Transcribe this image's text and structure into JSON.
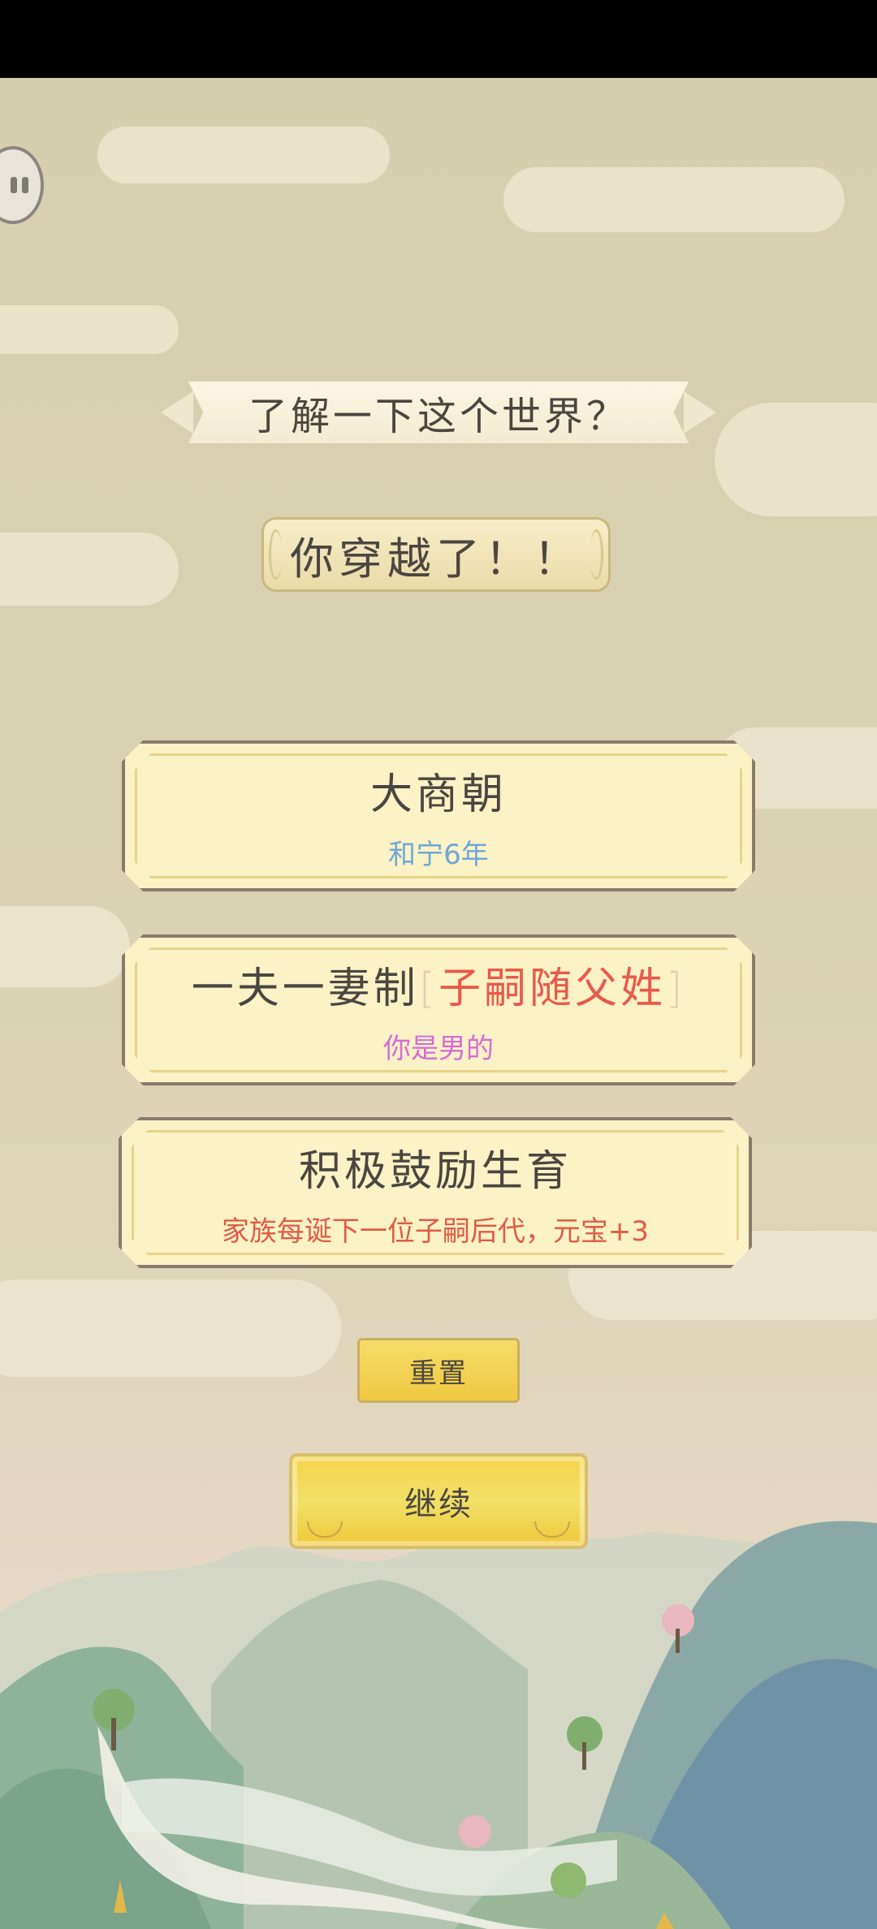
{
  "header": {
    "banner": "了解一下这个世界？",
    "plaque": "你穿越了！！"
  },
  "cards": [
    {
      "title": "大商朝",
      "subtitle": "和宁6年"
    },
    {
      "title": "一夫一妻制",
      "bracket_open": "[",
      "title_highlight": "子嗣随父姓",
      "bracket_close": "]",
      "subtitle": "你是男的"
    },
    {
      "title": "积极鼓励生育",
      "subtitle": "家族每诞下一位子嗣后代，元宝+3"
    }
  ],
  "buttons": {
    "reset": "重置",
    "continue": "继续"
  },
  "colors": {
    "card_fill": "#fbf2c6",
    "subtitle_blue": "#6fa8d8",
    "subtitle_pink": "#d86ad8",
    "subtitle_red": "#e05c45",
    "highlight_red": "#e85a4a",
    "button_gold": "#f2d04a"
  },
  "icons": {
    "pause": "pause-icon"
  }
}
